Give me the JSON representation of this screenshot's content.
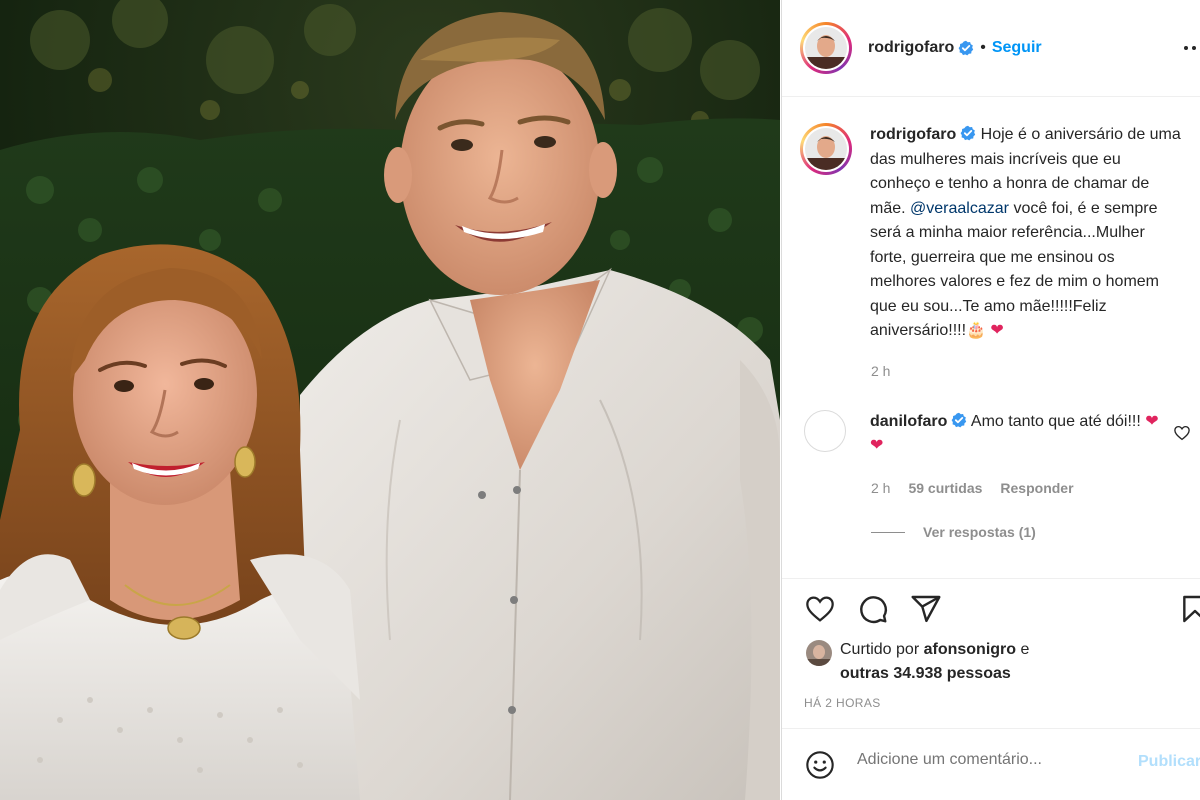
{
  "post": {
    "username": "rodrigofaro",
    "follow_label": "Seguir",
    "dot": "•",
    "caption": {
      "username": "rodrigofaro",
      "text_before_mention": "Hoje é o aniversário de uma das mulheres mais incríveis que eu conheço e tenho a honra de chamar de mãe.",
      "mention": "@veraalcazar",
      "text_after_mention": "você foi, é e sempre será a minha maior referência...Mulher forte, guerreira que me ensinou os melhores valores e fez de mim o homem que eu sou...Te amo mãe!!!!!Feliz aniversário!!!!",
      "emoji_cake": "🎂",
      "emoji_heart": "❤",
      "time": "2 h"
    },
    "comment": {
      "username": "danilofaro",
      "text": "Amo tanto que até dói!!!",
      "hearts": "❤ ❤",
      "time": "2 h",
      "likes": "59 curtidas",
      "reply_label": "Responder",
      "view_replies": "Ver respostas (1)"
    },
    "likes": {
      "prefix": "Curtido por",
      "user": "afonsonigro",
      "conj": "e",
      "others": "outras 34.938 pessoas"
    },
    "posted_ago": "HÁ 2 HORAS",
    "add_comment_placeholder": "Adicione um comentário...",
    "publish_label": "Publicar"
  },
  "icons": {
    "like": "heart-outline-icon",
    "comment": "comment-bubble-icon",
    "share": "paper-plane-icon",
    "save": "bookmark-icon",
    "emoji": "smiley-icon",
    "verified": "verified-badge-icon"
  },
  "colors": {
    "link_blue": "#0095f6",
    "mention": "#00376b",
    "muted": "#8e8e8e",
    "verified": "#3897f0",
    "heart_red": "#e0245e"
  }
}
